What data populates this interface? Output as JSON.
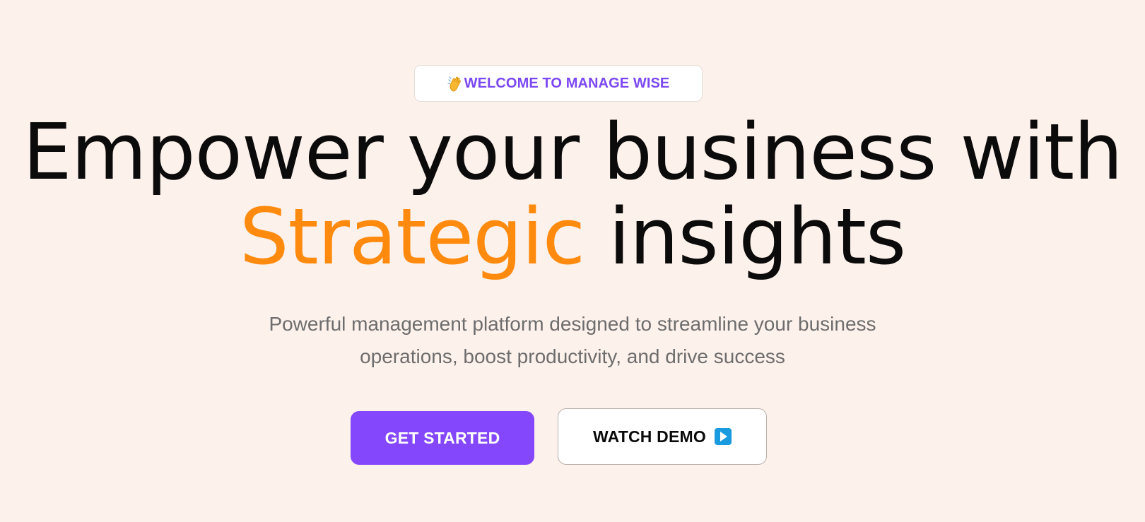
{
  "hero": {
    "badge": {
      "icon": "waving-hand-icon",
      "text": "WELCOME TO MANAGE WISE",
      "color": "#7c48f2"
    },
    "headline": {
      "line1": "Empower your business with",
      "accent": "Strategic",
      "rest": "insights",
      "accent_color": "#ff8a0e"
    },
    "subtitle": {
      "line1": "Powerful management platform designed to streamline your business",
      "line2": "operations, boost productivity, and drive success"
    },
    "buttons": {
      "primary_label": "GET STARTED",
      "primary_color": "#8447fb",
      "secondary_label": "WATCH DEMO",
      "secondary_icon": "play-button-icon"
    }
  }
}
